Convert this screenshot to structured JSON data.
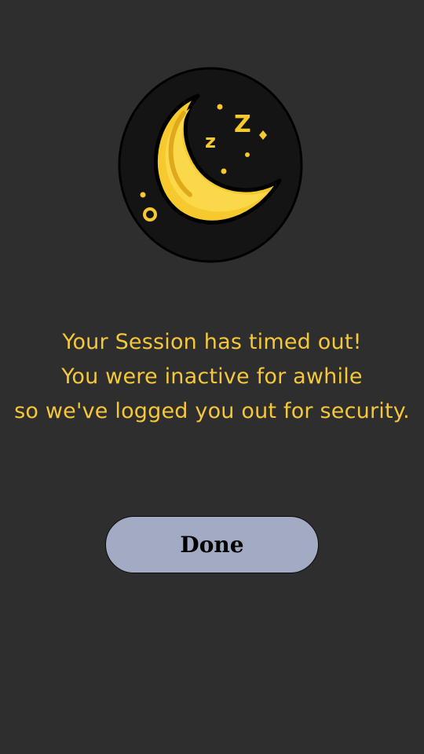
{
  "illustration": {
    "icon": "sleeping-moon-icon",
    "zz": [
      "z",
      "Z"
    ]
  },
  "message": {
    "line1": "Your Session has timed out!",
    "line2": "You were inactive for awhile",
    "line3": "so we've logged you out for security."
  },
  "done_button": {
    "label": "Done"
  },
  "colors": {
    "background": "#2e2e2e",
    "accent": "#f5c73a",
    "button": "#a3abc4"
  }
}
